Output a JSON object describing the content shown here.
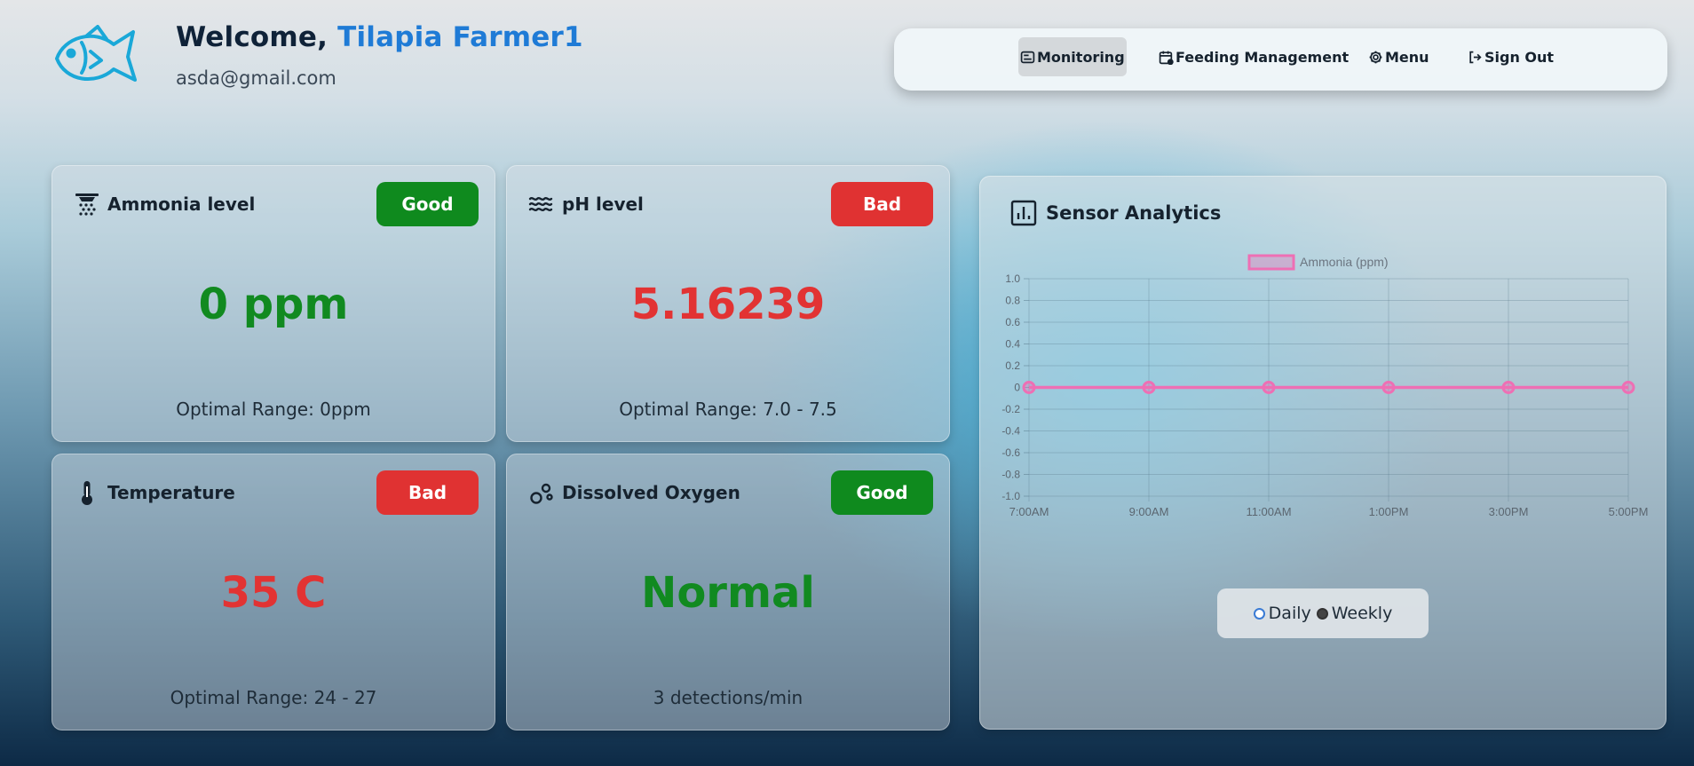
{
  "header": {
    "welcome_prefix": "Welcome,",
    "user_name": "Tilapia Farmer1",
    "email": "asda@gmail.com"
  },
  "nav": {
    "items": [
      {
        "label": "Monitoring",
        "icon": "monitor-icon",
        "active": true
      },
      {
        "label": "Feeding Management",
        "icon": "calendar-icon",
        "active": false
      },
      {
        "label": "Menu",
        "icon": "gear-icon",
        "active": false
      },
      {
        "label": "Sign Out",
        "icon": "sign-out-icon",
        "active": false
      }
    ]
  },
  "cards": {
    "ammonia": {
      "title": "Ammonia level",
      "status": "Good",
      "value": "0 ppm",
      "footer": "Optimal Range: 0ppm",
      "icon": "ammonia-sprinkler-icon"
    },
    "ph": {
      "title": "pH level",
      "status": "Bad",
      "value": "5.16239",
      "footer": "Optimal Range: 7.0 - 7.5",
      "icon": "water-waves-icon"
    },
    "temperature": {
      "title": "Temperature",
      "status": "Bad",
      "value": "35 C",
      "footer": "Optimal Range: 24 - 27",
      "icon": "thermometer-icon"
    },
    "oxygen": {
      "title": "Dissolved Oxygen",
      "status": "Good",
      "value": "Normal",
      "footer": "3 detections/min",
      "icon": "bubbles-icon"
    }
  },
  "colors": {
    "good": "#0f8a1e",
    "bad": "#e03232",
    "accent": "#1f7bd6",
    "series": "#ee6fb4"
  },
  "analytics": {
    "title": "Sensor Analytics",
    "toggle": {
      "daily": "Daily",
      "weekly": "Weekly",
      "selected": "Weekly"
    }
  },
  "chart_data": {
    "type": "line",
    "x": [
      "7:00AM",
      "9:00AM",
      "11:00AM",
      "1:00PM",
      "3:00PM",
      "5:00PM"
    ],
    "series": [
      {
        "name": "Ammonia (ppm)",
        "values": [
          0,
          0,
          0,
          0,
          0,
          0
        ]
      }
    ],
    "ylim": [
      -1.0,
      1.0
    ],
    "yticks": [
      "1.0",
      "0.8",
      "0.6",
      "0.4",
      "0.2",
      "0",
      "-0.2",
      "-0.4",
      "-0.6",
      "-0.8",
      "-1.0"
    ],
    "grid": true,
    "legend": "top-center"
  }
}
